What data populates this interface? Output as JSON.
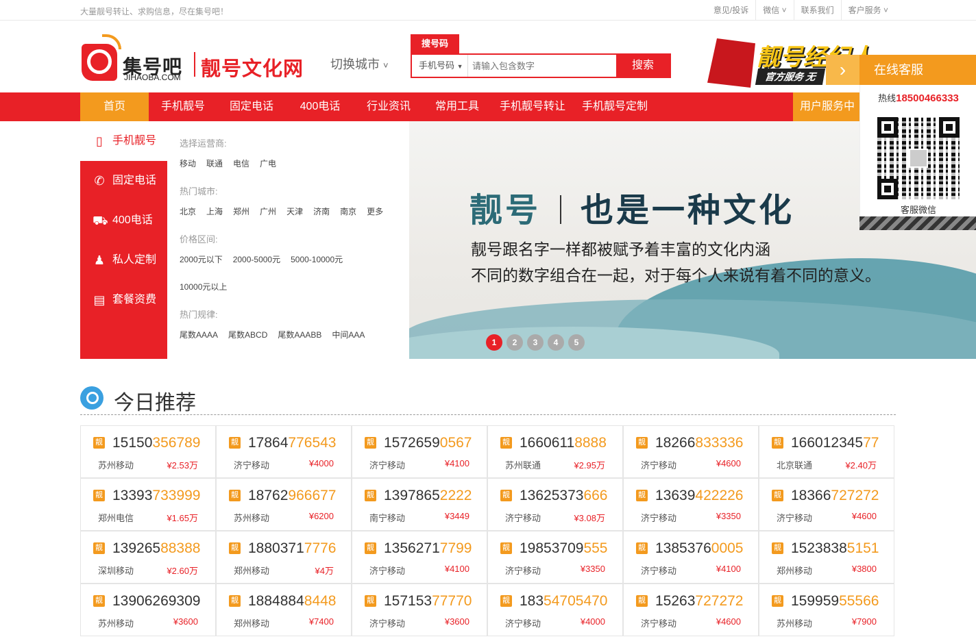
{
  "topbar": {
    "slogan": "大量靓号转让、求购信息，尽在集号吧！",
    "links": [
      "意见/投诉",
      "微信",
      "联系我们",
      "客户服务"
    ]
  },
  "header": {
    "logo_cn": "集号吧",
    "logo_en": "JIHAOBA.COM",
    "site_name": "靓号文化网",
    "city_switch": "切换城市",
    "search_tab": "搜号码",
    "search_select": "手机号码",
    "search_placeholder": "请输入包含数字",
    "search_button": "搜索",
    "ad_title": "靓号经纪人",
    "ad_sub": "官方服务 无"
  },
  "nav": {
    "items": [
      "首页",
      "手机靓号",
      "固定电话",
      "400电话",
      "行业资讯",
      "常用工具",
      "手机靓号转让",
      "手机靓号定制"
    ],
    "user": "用户服务中"
  },
  "sidebar": {
    "items": [
      {
        "label": "手机靓号",
        "icon": "phone-icon"
      },
      {
        "label": "固定电话",
        "icon": "telephone-icon"
      },
      {
        "label": "400电话",
        "icon": "car-icon"
      },
      {
        "label": "私人定制",
        "icon": "qq-penguin-icon"
      },
      {
        "label": "套餐资费",
        "icon": "package-fee-icon"
      }
    ]
  },
  "filter": {
    "carrier_title": "选择运营商:",
    "carriers": [
      "移动",
      "联通",
      "电信",
      "广电"
    ],
    "city_title": "热门城市:",
    "cities": [
      "北京",
      "上海",
      "郑州",
      "广州",
      "天津",
      "济南",
      "南京",
      "更多"
    ],
    "price_title": "价格区间:",
    "prices": [
      "2000元以下",
      "2000-5000元",
      "5000-10000元",
      "10000元以上"
    ],
    "rule_title": "热门规律:",
    "rules": [
      "尾数AAAA",
      "尾数ABCD",
      "尾数AAABB",
      "中间AAA"
    ]
  },
  "slider": {
    "title_a": "靓号",
    "title_b": "也是一种文化",
    "line1": "靓号跟名字一样都被赋予着丰富的文化内涵",
    "line2": "不同的数字组合在一起，对于每个人来说有着不同的意义。",
    "dots": [
      "1",
      "2",
      "3",
      "4",
      "5"
    ]
  },
  "service": {
    "title": "在线客服",
    "hotline_label": "热线",
    "hotline": "18500466333",
    "qr_label": "客服微信"
  },
  "section": {
    "title": "今日推荐",
    "tag": "靓"
  },
  "numbers": [
    {
      "p": "15150",
      "h": "356789",
      "loc": "苏州移动",
      "price": "¥2.53万"
    },
    {
      "p": "17864",
      "h": "776543",
      "loc": "济宁移动",
      "price": "¥4000"
    },
    {
      "p": "1572659",
      "h": "0567",
      "loc": "济宁移动",
      "price": "¥4100"
    },
    {
      "p": "1660611",
      "h": "8888",
      "loc": "苏州联通",
      "price": "¥2.95万"
    },
    {
      "p": "18266",
      "h": "833336",
      "loc": "济宁移动",
      "price": "¥4600"
    },
    {
      "p": "166012345",
      "h": "77",
      "loc": "北京联通",
      "price": "¥2.40万"
    },
    {
      "p": "13393",
      "h": "733999",
      "loc": "郑州电信",
      "price": "¥1.65万"
    },
    {
      "p": "18762",
      "h": "966677",
      "loc": "苏州移动",
      "price": "¥6200"
    },
    {
      "p": "1397865",
      "h": "2222",
      "loc": "南宁移动",
      "price": "¥3449"
    },
    {
      "p": "13625373",
      "h": "666",
      "loc": "济宁移动",
      "price": "¥3.08万"
    },
    {
      "p": "13639",
      "h": "422226",
      "loc": "济宁移动",
      "price": "¥3350"
    },
    {
      "p": "18366",
      "h": "727272",
      "loc": "济宁移动",
      "price": "¥4600"
    },
    {
      "p": "139265",
      "h": "88388",
      "loc": "深圳移动",
      "price": "¥2.60万"
    },
    {
      "p": "1880371",
      "h": "7776",
      "loc": "郑州移动",
      "price": "¥4万"
    },
    {
      "p": "1356271",
      "h": "7799",
      "loc": "济宁移动",
      "price": "¥4100"
    },
    {
      "p": "19853709",
      "h": "555",
      "loc": "济宁移动",
      "price": "¥3350"
    },
    {
      "p": "1385376",
      "h": "0005",
      "loc": "济宁移动",
      "price": "¥4100"
    },
    {
      "p": "1523838",
      "h": "5151",
      "loc": "郑州移动",
      "price": "¥3800"
    },
    {
      "p": "13906269309",
      "h": "",
      "loc": "苏州移动",
      "price": "¥3600"
    },
    {
      "p": "1884884",
      "h": "8448",
      "loc": "郑州移动",
      "price": "¥7400"
    },
    {
      "p": "157153",
      "h": "77770",
      "loc": "济宁移动",
      "price": "¥3600"
    },
    {
      "p": "183",
      "h": "54705470",
      "loc": "济宁移动",
      "price": "¥4000"
    },
    {
      "p": "15263",
      "h": "727272",
      "loc": "济宁移动",
      "price": "¥4600"
    },
    {
      "p": "159959",
      "h": "55566",
      "loc": "苏州移动",
      "price": "¥7900"
    }
  ]
}
